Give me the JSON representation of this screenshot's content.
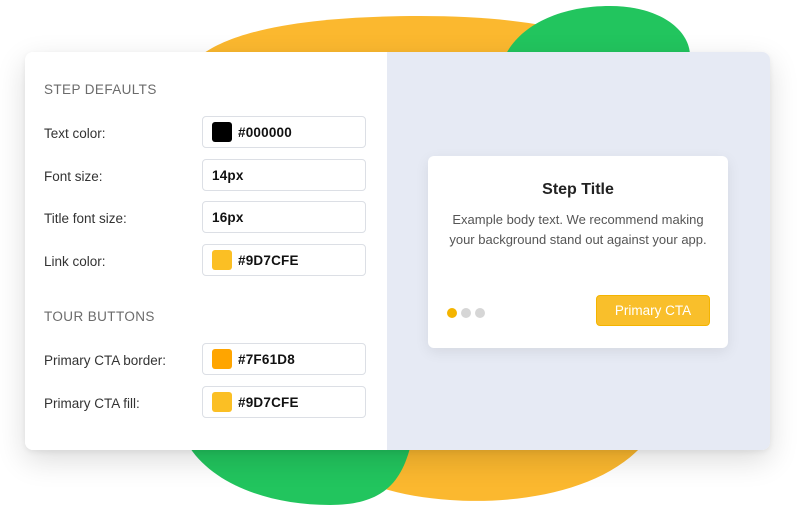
{
  "colors": {
    "blob_yellow": "#FBB82F",
    "blob_green": "#22C55E",
    "preview_bg": "#E6EAF4",
    "cta_fill": "#F9BF2B",
    "dot_active": "#F4B400",
    "dot_inactive": "#D6D6D6"
  },
  "step_defaults": {
    "title": "STEP DEFAULTS",
    "text_color": {
      "label": "Text color:",
      "value": "#000000",
      "swatch": "#000000"
    },
    "font_size": {
      "label": "Font size:",
      "value": "14px"
    },
    "title_font_size": {
      "label": "Title font size:",
      "value": "16px"
    },
    "link_color": {
      "label": "Link color:",
      "value": "#9D7CFE",
      "swatch": "#FBBF24"
    }
  },
  "tour_buttons": {
    "title": "TOUR BUTTONS",
    "primary_cta_border": {
      "label": "Primary CTA border:",
      "value": "#7F61D8",
      "swatch": "#FFA500"
    },
    "primary_cta_fill": {
      "label": "Primary CTA fill:",
      "value": "#9D7CFE",
      "swatch": "#FBBF24"
    }
  },
  "preview": {
    "step_title": "Step Title",
    "body": "Example body text. We recommend making your background stand out against your app.",
    "dots": {
      "total": 3,
      "active_index": 0
    },
    "cta_label": "Primary CTA"
  }
}
